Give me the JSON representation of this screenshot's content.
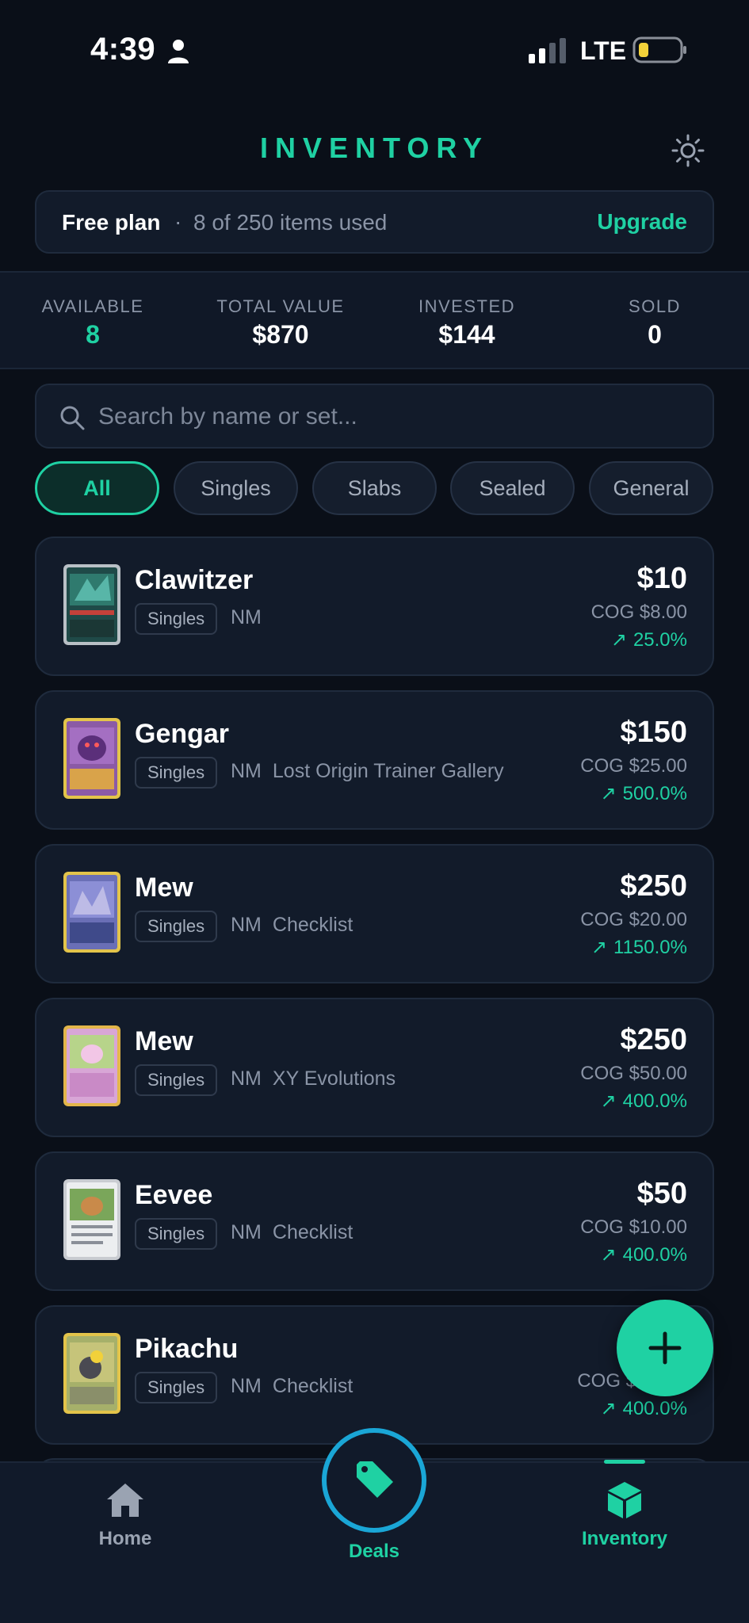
{
  "status_bar": {
    "time": "4:39",
    "network": "LTE"
  },
  "header": {
    "title": "INVENTORY"
  },
  "plan": {
    "name": "Free plan",
    "separator": "·",
    "usage": "8 of 250 items used",
    "upgrade": "Upgrade"
  },
  "stats": [
    {
      "label": "AVAILABLE",
      "value": "8"
    },
    {
      "label": "TOTAL VALUE",
      "value": "$870"
    },
    {
      "label": "INVESTED",
      "value": "$144"
    },
    {
      "label": "SOLD",
      "value": "0"
    }
  ],
  "search": {
    "placeholder": "Search by name or set..."
  },
  "filters": [
    "All",
    "Singles",
    "Slabs",
    "Sealed",
    "General"
  ],
  "items": [
    {
      "name": "Clawitzer",
      "category": "Singles",
      "condition": "NM",
      "set": "",
      "price": "$10",
      "cog": "COG $8.00",
      "gain": "25.0%"
    },
    {
      "name": "Gengar",
      "category": "Singles",
      "condition": "NM",
      "set": "Lost Origin Trainer Gallery",
      "price": "$150",
      "cog": "COG $25.00",
      "gain": "500.0%"
    },
    {
      "name": "Mew",
      "category": "Singles",
      "condition": "NM",
      "set": "Checklist",
      "price": "$250",
      "cog": "COG $20.00",
      "gain": "1150.0%"
    },
    {
      "name": "Mew",
      "category": "Singles",
      "condition": "NM",
      "set": "XY Evolutions",
      "price": "$250",
      "cog": "COG $50.00",
      "gain": "400.0%"
    },
    {
      "name": "Eevee",
      "category": "Singles",
      "condition": "NM",
      "set": "Checklist",
      "price": "$50",
      "cog": "COG $10.00",
      "gain": "400.0%"
    },
    {
      "name": "Pikachu",
      "category": "Singles",
      "condition": "NM",
      "set": "Checklist",
      "price": "",
      "cog": "COG $",
      "gain": "400.0%"
    }
  ],
  "nav": {
    "home": "Home",
    "deals": "Deals",
    "inventory": "Inventory"
  },
  "colors": {
    "accent": "#1fd1a3",
    "background": "#0a0f18",
    "card": "#121b2a",
    "deals_ring": "#1aa6d6"
  }
}
